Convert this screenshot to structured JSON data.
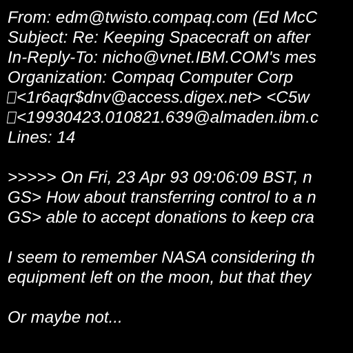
{
  "colors": {
    "background": "#000000",
    "text": "#ffffff"
  },
  "header": {
    "from": "From: edm@twisto.compaq.com (Ed McC",
    "subject": "Subject: Re: Keeping Spacecraft on after",
    "in_reply_to": "In-Reply-To: nicho@vnet.IBM.COM's mes",
    "organization": "Organization: Compaq Computer Corp",
    "references_1": "<1r6aqr$dnv@access.digex.net> <C5w",
    "references_2": "<19930423.010821.639@almaden.ibm.c",
    "lines": "Lines: 14"
  },
  "body": {
    "quote_1": ">>>>> On Fri, 23 Apr 93 09:06:09 BST, n",
    "quote_2": "GS> How about transferring control to a n",
    "quote_3": "GS> able to accept donations to keep cra",
    "para_1_line_1": "I seem to remember NASA considering th",
    "para_1_line_2": "equipment left on the moon, but that they",
    "para_2": "Or maybe not..."
  },
  "icons": {
    "missing_glyph": "missing-character-box-icon"
  }
}
